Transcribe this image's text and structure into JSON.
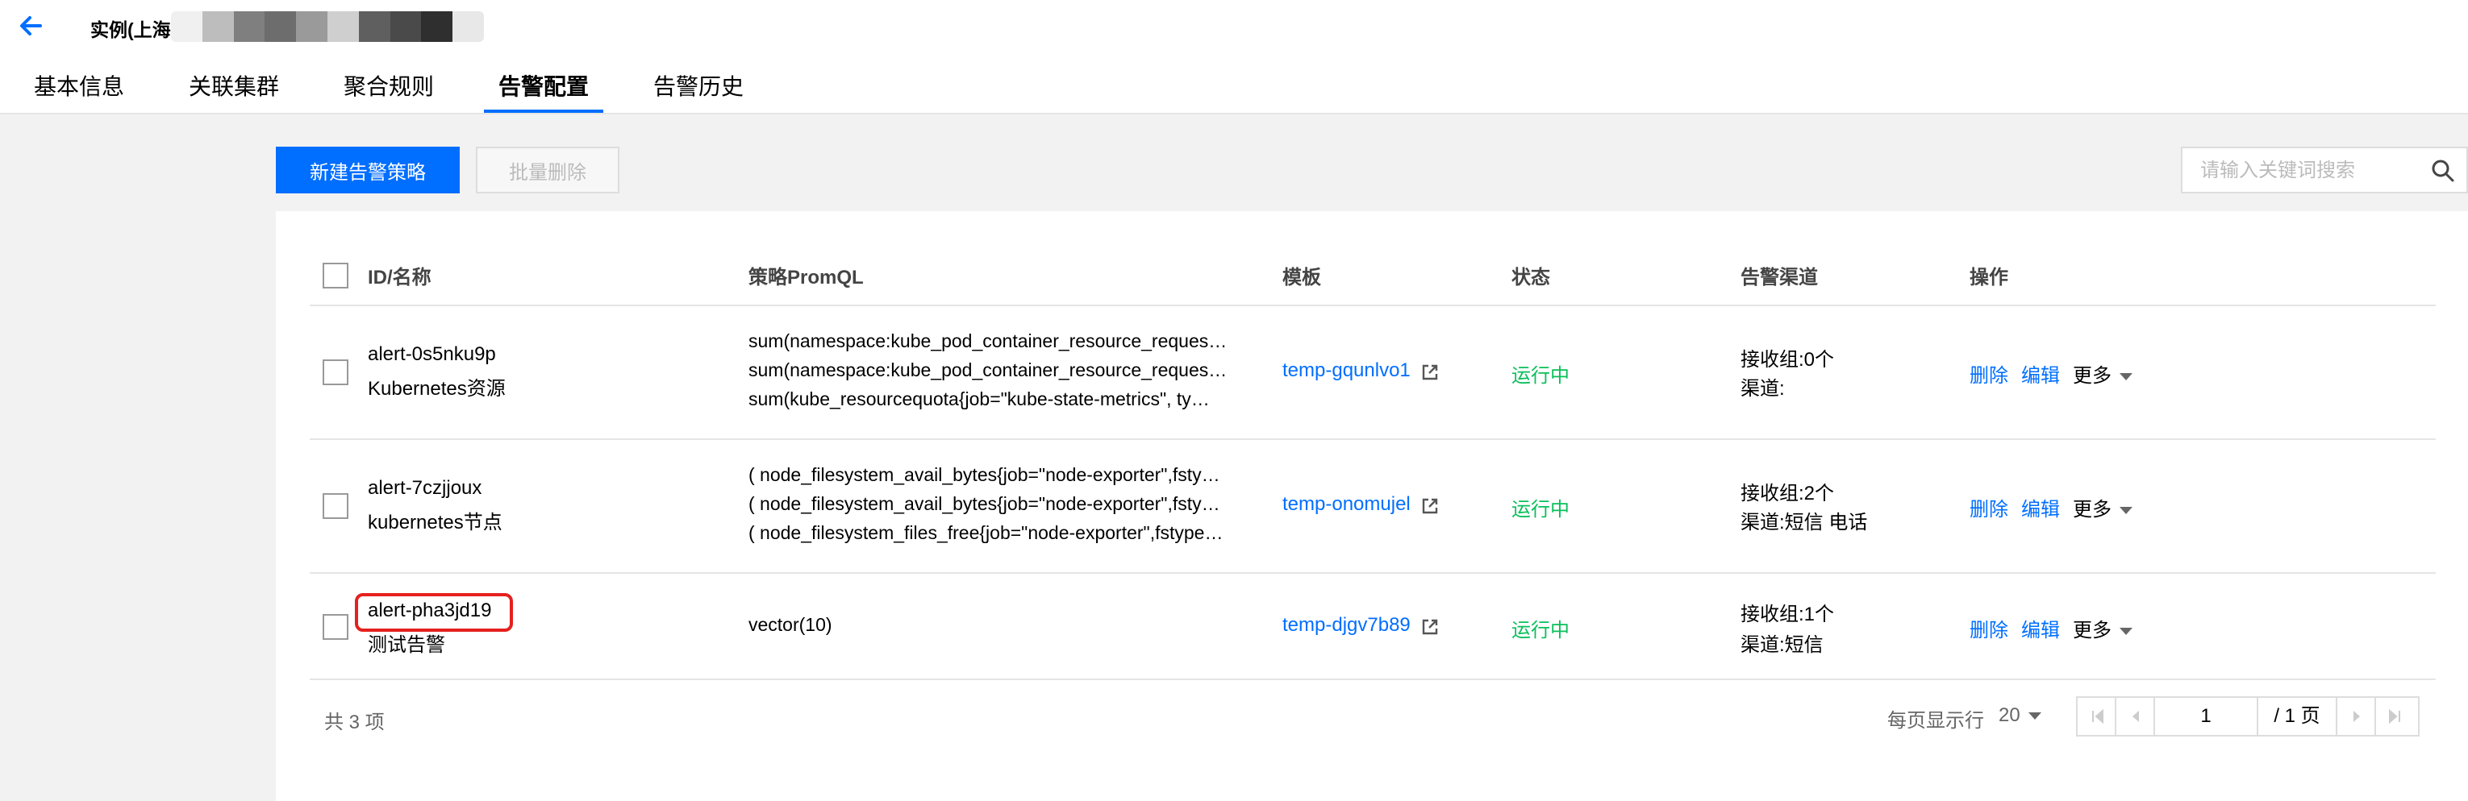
{
  "header": {
    "title": "实例(上海"
  },
  "colors": {
    "accent": "#006eff",
    "running": "#0abf5b",
    "highlight": "#e5201e",
    "mosaic": [
      "#f0f0f0",
      "#bdbdbd",
      "#7f7f7f",
      "#6d6d6d",
      "#9a9a9a",
      "#cfcfcf",
      "#5f5f5f",
      "#4a4a4a",
      "#2f2f2f",
      "#e8e8e8"
    ]
  },
  "tabs": [
    {
      "label": "基本信息",
      "active": false
    },
    {
      "label": "关联集群",
      "active": false
    },
    {
      "label": "聚合规则",
      "active": false
    },
    {
      "label": "告警配置",
      "active": true
    },
    {
      "label": "告警历史",
      "active": false
    }
  ],
  "toolbar": {
    "create_label": "新建告警策略",
    "bulk_delete_label": "批量删除"
  },
  "search": {
    "placeholder": "请输入关键词搜索",
    "icon": "search-icon"
  },
  "table": {
    "columns": [
      "ID/名称",
      "策略PromQL",
      "模板",
      "状态",
      "告警渠道",
      "操作"
    ],
    "rows": [
      {
        "id": "alert-0s5nku9p",
        "name": "Kubernetes资源",
        "promql": [
          "sum(namespace:kube_pod_container_resource_reques…",
          "sum(namespace:kube_pod_container_resource_reques…",
          "sum(kube_resourcequota{job=\"kube-state-metrics\", ty…"
        ],
        "template": "temp-gqunlvo1",
        "status": "运行中",
        "receivers": "接收组:0个",
        "channels": "渠道:",
        "actions": {
          "delete": "删除",
          "edit": "编辑",
          "more": "更多"
        }
      },
      {
        "id": "alert-7czjjoux",
        "name": "kubernetes节点",
        "promql": [
          "( node_filesystem_avail_bytes{job=\"node-exporter\",fsty…",
          "( node_filesystem_avail_bytes{job=\"node-exporter\",fsty…",
          "( node_filesystem_files_free{job=\"node-exporter\",fstype…"
        ],
        "template": "temp-onomujel",
        "status": "运行中",
        "receivers": "接收组:2个",
        "channels": "渠道:短信 电话",
        "actions": {
          "delete": "删除",
          "edit": "编辑",
          "more": "更多"
        }
      },
      {
        "id": "alert-pha3jd19",
        "name": "测试告警",
        "promql": [
          "vector(10)"
        ],
        "template": "temp-djgv7b89",
        "status": "运行中",
        "receivers": "接收组:1个",
        "channels": "渠道:短信",
        "actions": {
          "delete": "删除",
          "edit": "编辑",
          "more": "更多"
        }
      }
    ]
  },
  "footer": {
    "total": "共 3 项",
    "per_page_label": "每页显示行",
    "per_page_value": "20",
    "page_input": "1",
    "page_total": "/ 1 页"
  }
}
